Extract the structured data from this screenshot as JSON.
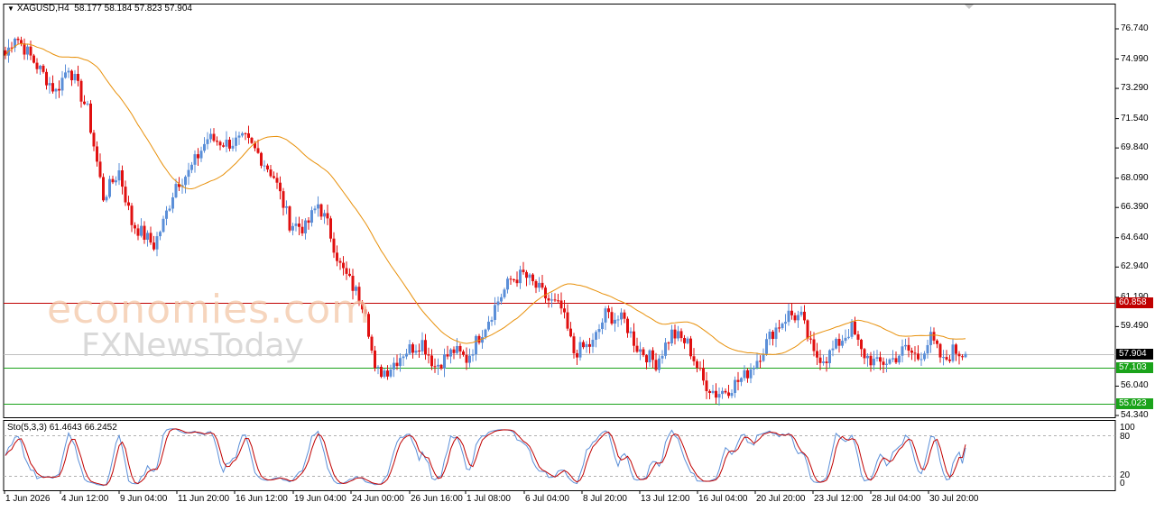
{
  "header": {
    "symbol": "XAGUSD,H4",
    "ohlc": "58.177 58.184 57.823 57.904"
  },
  "stochastic": {
    "label": "Sto(5,3,3) 61.4643 66.2452",
    "ticks": [
      "100",
      "80",
      "20",
      "0"
    ]
  },
  "watermark": {
    "line1": "economies.com",
    "line2": "FXNewsToday"
  },
  "price_axis": {
    "ticks": [
      "76.740",
      "74.990",
      "73.290",
      "71.540",
      "69.840",
      "68.090",
      "66.390",
      "64.640",
      "62.940",
      "61.190",
      "59.490",
      "56.040",
      "54.340"
    ]
  },
  "levels": {
    "resistance": {
      "label": "60.858",
      "value": 60.858,
      "color": "#c00000"
    },
    "current": {
      "label": "57.904",
      "value": 57.904,
      "color": "#000000"
    },
    "support1": {
      "label": "57.103",
      "value": 57.103,
      "color": "#1aa31a"
    },
    "support2": {
      "label": "55.023",
      "value": 55.023,
      "color": "#1aa31a"
    }
  },
  "time_axis": {
    "ticks": [
      "1 Jun 2026",
      "4 Jun 12:00",
      "9 Jun 04:00",
      "11 Jun 20:00",
      "16 Jun 12:00",
      "19 Jun 04:00",
      "24 Jun 00:00",
      "26 Jun 16:00",
      "1 Jul 08:00",
      "6 Jul 04:00",
      "8 Jul 20:00",
      "13 Jul 12:00",
      "16 Jul 04:00",
      "20 Jul 20:00",
      "23 Jul 12:00",
      "28 Jul 04:00",
      "30 Jul 20:00"
    ]
  },
  "colors": {
    "bull": "#5b8fd8",
    "bear": "#e01010",
    "ma": "#e8900a",
    "sto_k": "#5b8fd8",
    "sto_d": "#c00000"
  },
  "chart_data": {
    "type": "candlestick",
    "symbol": "XAGUSD",
    "timeframe": "H4",
    "ylim": [
      54.34,
      76.74
    ],
    "price_path_anchors": [
      {
        "i": 0,
        "price": 75.2
      },
      {
        "i": 3,
        "price": 76.4
      },
      {
        "i": 10,
        "price": 74.6
      },
      {
        "i": 16,
        "price": 73.1
      },
      {
        "i": 20,
        "price": 74.6
      },
      {
        "i": 26,
        "price": 72.0
      },
      {
        "i": 31,
        "price": 67.0
      },
      {
        "i": 36,
        "price": 68.5
      },
      {
        "i": 40,
        "price": 65.5
      },
      {
        "i": 47,
        "price": 64.2
      },
      {
        "i": 50,
        "price": 65.5
      },
      {
        "i": 54,
        "price": 67.8
      },
      {
        "i": 58,
        "price": 68.4
      },
      {
        "i": 64,
        "price": 70.4
      },
      {
        "i": 70,
        "price": 70.1
      },
      {
        "i": 76,
        "price": 70.3
      },
      {
        "i": 80,
        "price": 69.5
      },
      {
        "i": 85,
        "price": 68.2
      },
      {
        "i": 90,
        "price": 65.5
      },
      {
        "i": 95,
        "price": 65.2
      },
      {
        "i": 99,
        "price": 66.6
      },
      {
        "i": 102,
        "price": 65.4
      },
      {
        "i": 106,
        "price": 63.0
      },
      {
        "i": 110,
        "price": 61.8
      },
      {
        "i": 114,
        "price": 60.6
      },
      {
        "i": 117,
        "price": 56.8
      },
      {
        "i": 121,
        "price": 57.0
      },
      {
        "i": 126,
        "price": 58.0
      },
      {
        "i": 132,
        "price": 58.6
      },
      {
        "i": 136,
        "price": 57.2
      },
      {
        "i": 142,
        "price": 58.1
      },
      {
        "i": 146,
        "price": 57.6
      },
      {
        "i": 152,
        "price": 59.6
      },
      {
        "i": 156,
        "price": 61.0
      },
      {
        "i": 160,
        "price": 62.2
      },
      {
        "i": 164,
        "price": 62.5
      },
      {
        "i": 169,
        "price": 61.6
      },
      {
        "i": 172,
        "price": 61.0
      },
      {
        "i": 176,
        "price": 60.5
      },
      {
        "i": 180,
        "price": 58.0
      },
      {
        "i": 186,
        "price": 58.5
      },
      {
        "i": 190,
        "price": 60.2
      },
      {
        "i": 196,
        "price": 59.8
      },
      {
        "i": 200,
        "price": 58.3
      },
      {
        "i": 206,
        "price": 57.4
      },
      {
        "i": 211,
        "price": 59.1
      },
      {
        "i": 216,
        "price": 58.5
      },
      {
        "i": 221,
        "price": 56.3
      },
      {
        "i": 225,
        "price": 55.6
      },
      {
        "i": 229,
        "price": 55.9
      },
      {
        "i": 234,
        "price": 56.6
      },
      {
        "i": 238,
        "price": 57.6
      },
      {
        "i": 243,
        "price": 59.2
      },
      {
        "i": 248,
        "price": 60.2
      },
      {
        "i": 252,
        "price": 60.0
      },
      {
        "i": 256,
        "price": 57.8
      },
      {
        "i": 260,
        "price": 57.7
      },
      {
        "i": 265,
        "price": 58.8
      },
      {
        "i": 268,
        "price": 59.4
      },
      {
        "i": 271,
        "price": 58.0
      },
      {
        "i": 276,
        "price": 57.3
      },
      {
        "i": 281,
        "price": 57.6
      },
      {
        "i": 285,
        "price": 58.2
      },
      {
        "i": 289,
        "price": 57.7
      },
      {
        "i": 293,
        "price": 58.8
      },
      {
        "i": 297,
        "price": 57.4
      },
      {
        "i": 300,
        "price": 58.1
      },
      {
        "i": 304,
        "price": 57.9
      }
    ],
    "indicators": {
      "moving_average_color": "#e8900a",
      "stochastic": {
        "params": "5,3,3",
        "k": 61.4643,
        "d": 66.2452,
        "levels": [
          20,
          80
        ],
        "ylim": [
          0,
          100
        ]
      }
    }
  }
}
